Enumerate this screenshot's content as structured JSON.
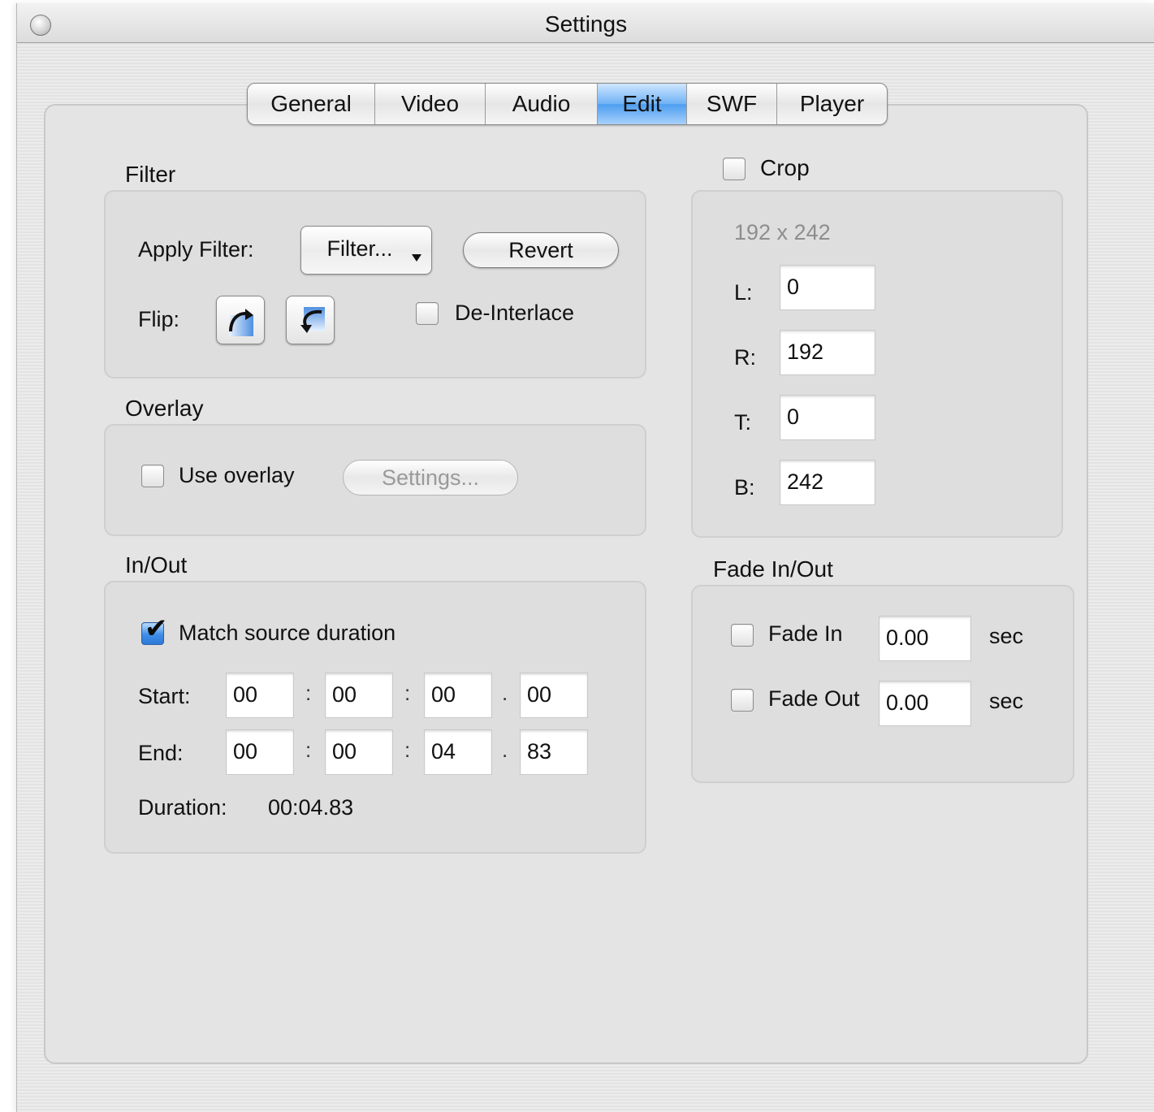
{
  "window": {
    "title": "Settings"
  },
  "tabs": [
    {
      "label": "General",
      "active": false
    },
    {
      "label": "Video",
      "active": false
    },
    {
      "label": "Audio",
      "active": false
    },
    {
      "label": "Edit",
      "active": true
    },
    {
      "label": "SWF",
      "active": false
    },
    {
      "label": "Player",
      "active": false
    }
  ],
  "filter": {
    "title": "Filter",
    "apply_label": "Apply Filter:",
    "filter_button": "Filter...",
    "revert_button": "Revert",
    "flip_label": "Flip:",
    "flip_vertical_icon": "flip-vertical-icon",
    "flip_horizontal_icon": "flip-horizontal-icon",
    "deinterlace_label": "De-Interlace",
    "deinterlace_checked": false
  },
  "overlay": {
    "title": "Overlay",
    "use_overlay_label": "Use overlay",
    "use_overlay_checked": false,
    "settings_button": "Settings..."
  },
  "inout": {
    "title": "In/Out",
    "match_label": "Match source duration",
    "match_checked": true,
    "start_label": "Start:",
    "end_label": "End:",
    "start": [
      "00",
      "00",
      "00",
      "00"
    ],
    "end": [
      "00",
      "00",
      "04",
      "83"
    ],
    "sep_colon": ":",
    "sep_dot": ".",
    "duration_label": "Duration:",
    "duration_value": "00:04.83"
  },
  "crop": {
    "title": "Crop",
    "checked": false,
    "dimensions": "192 x 242",
    "l_label": "L:",
    "l_value": "0",
    "r_label": "R:",
    "r_value": "192",
    "t_label": "T:",
    "t_value": "0",
    "b_label": "B:",
    "b_value": "242"
  },
  "fade": {
    "title": "Fade In/Out",
    "fade_in_label": "Fade In",
    "fade_in_checked": false,
    "fade_in_value": "0.00",
    "fade_out_label": "Fade Out",
    "fade_out_checked": false,
    "fade_out_value": "0.00",
    "unit": "sec"
  },
  "colors": {
    "active_tab": "#4d9ef0",
    "checkbox_checked": "#3f8ee8",
    "disabled_text": "#9a9a9a"
  }
}
